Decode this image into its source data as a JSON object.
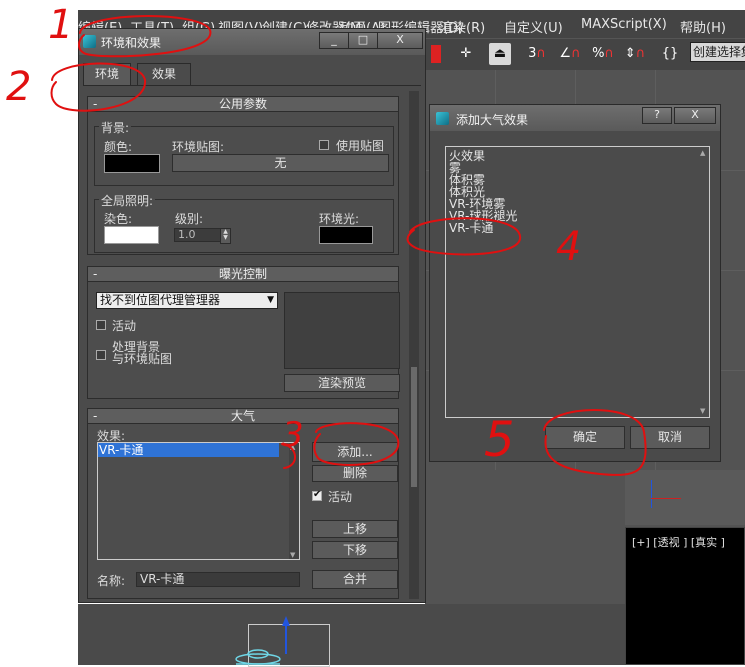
{
  "background_app": {
    "menus": [
      "编辑(E)",
      "工具(T)",
      "组(G)",
      "视图(V)",
      "创建(C)",
      "修改器(M)",
      "动画(A)",
      "图形编辑器(D)",
      "渲染(R)",
      "自定义(U)",
      "MAXScript(X)",
      "帮助(H)"
    ],
    "toolbar": {
      "snap_3": "3",
      "snap_percent": "%",
      "selection_set_placeholder": "创建选择集"
    },
    "viewport_label": "[+] [透视 ] [真实 ]"
  },
  "env_dialog": {
    "title": "环境和效果",
    "window_buttons": [
      "_",
      "□",
      "X"
    ],
    "tabs": [
      {
        "label": "环境",
        "active": true
      },
      {
        "label": "效果",
        "active": false
      }
    ],
    "common_params": {
      "header": "公用参数",
      "background_group": "背景:",
      "color_label": "颜色:",
      "env_map_label": "环境贴图:",
      "use_map_label": "使用贴图",
      "use_map_checked": false,
      "env_map_button": "无",
      "background_color": "#000000",
      "global_lighting_group": "全局照明:",
      "tint_label": "染色:",
      "level_label": "级别:",
      "level_value": "1.0",
      "ambient_label": "环境光:",
      "tint_color": "#ffffff",
      "ambient_color": "#000000"
    },
    "exposure": {
      "header": "曝光控制",
      "dropdown_value": "找不到位图代理管理器",
      "active_label": "活动",
      "active_checked": false,
      "process_bg_label_line1": "处理背景",
      "process_bg_label_line2": "与环境贴图",
      "process_bg_checked": false,
      "render_preview_button": "渲染预览"
    },
    "atmosphere": {
      "header": "大气",
      "effects_label": "效果:",
      "effects": [
        {
          "label": "VR-卡通",
          "selected": true
        }
      ],
      "add_button": "添加...",
      "delete_button": "删除",
      "active_label": "活动",
      "active_checked": true,
      "move_up_button": "上移",
      "move_down_button": "下移",
      "name_label": "名称:",
      "name_value": "VR-卡通",
      "merge_button": "合并"
    }
  },
  "add_dialog": {
    "title": "添加大气效果",
    "help_button": "?",
    "close_button": "X",
    "items": [
      "火效果",
      "雾",
      "体积雾",
      "体积光",
      "VR-环境雾",
      "VR-球形褪光",
      "VR-卡通"
    ],
    "ok_button": "确定",
    "cancel_button": "取消"
  },
  "annotations": {
    "numbers": [
      "1",
      "2",
      "3",
      "4",
      "5"
    ],
    "color": "#e01010"
  }
}
